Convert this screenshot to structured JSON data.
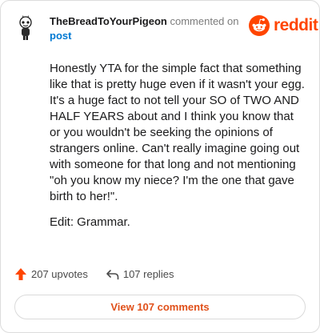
{
  "comment": {
    "author": "TheBreadToYourPigeon",
    "action": "commented on",
    "target": "post",
    "paragraphs": [
      "Honestly YTA for the simple fact that something like that is pretty huge even if it wasn't your egg. It's a huge fact to not tell your SO of TWO AND HALF YEARS about and I think you know that or you wouldn't be seeking the opinions of strangers online. Can't really imagine going out with someone for that long and not mentioning \"oh you know my niece? I'm the one that gave birth to her!\".",
      "Edit: Grammar."
    ]
  },
  "brand": {
    "name": "reddit",
    "icon": "reddit-alien-icon",
    "color": "#ff4500"
  },
  "stats": {
    "upvotes": "207 upvotes",
    "replies": "107 replies",
    "upvote_icon": "upvote-arrow-icon",
    "reply_icon": "reply-arrow-icon",
    "upvote_color": "#ff4500"
  },
  "view_button": {
    "label": "View 107 comments",
    "color": "#e0501a"
  }
}
